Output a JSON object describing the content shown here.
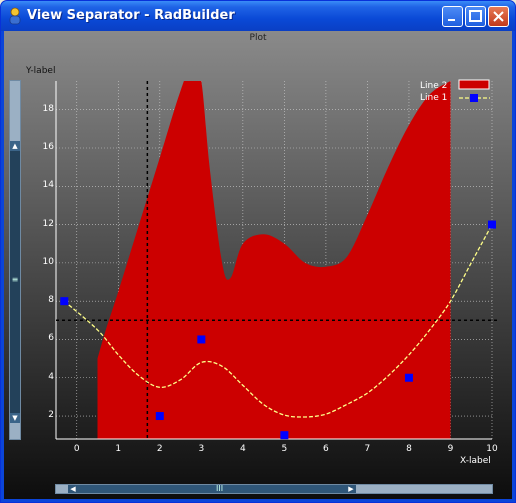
{
  "window": {
    "title": "View Separator - RadBuilder",
    "buttons": [
      "minimize",
      "maximize",
      "close"
    ]
  },
  "plot": {
    "title": "Plot",
    "ylabel": "Y-label",
    "xlabel": "X-label"
  },
  "chart_data": {
    "type": "area",
    "title": "Plot",
    "xlabel": "X-label",
    "ylabel": "Y-label",
    "xlim": [
      -0.5,
      10
    ],
    "ylim": [
      0.8,
      19.5
    ],
    "xticks": [
      "0",
      "1",
      "2",
      "3",
      "4",
      "5",
      "6",
      "7",
      "8",
      "9",
      "10"
    ],
    "yticks": [
      "2",
      "4",
      "6",
      "8",
      "10",
      "12",
      "14",
      "16",
      "18"
    ],
    "grid": true,
    "legend_placement": "top-right",
    "crosshair": {
      "x": 1.7,
      "y": 7.0
    },
    "series": [
      {
        "name": "Line 2",
        "kind": "filled-area",
        "color": "#cc0000",
        "x": [
          0.5,
          0.7,
          1.0,
          1.5,
          2.0,
          2.5,
          2.8,
          3.0,
          3.2,
          3.5,
          3.7,
          4.0,
          4.5,
          5.0,
          5.5,
          6.0,
          6.5,
          7.0,
          7.5,
          8.0,
          8.5,
          9.0
        ],
        "values": [
          5.0,
          6.5,
          8.5,
          12.0,
          15.5,
          19.0,
          20.5,
          19.5,
          15.0,
          10.0,
          9.2,
          11.0,
          11.5,
          11.0,
          10.0,
          9.8,
          10.3,
          12.5,
          15.0,
          17.2,
          18.8,
          19.5
        ]
      },
      {
        "name": "Line 1",
        "kind": "dashed-line-with-markers",
        "color": "#ffff88",
        "marker_color": "#0000ff",
        "x": [
          -0.3,
          2.0,
          3.0,
          5.0,
          8.0,
          10.0
        ],
        "values": [
          8.0,
          2.0,
          6.0,
          1.0,
          4.0,
          12.0
        ],
        "curve_x": [
          -0.3,
          0.5,
          1.0,
          1.5,
          2.0,
          2.5,
          3.0,
          3.5,
          4.0,
          4.5,
          5.0,
          5.5,
          6.0,
          6.5,
          7.0,
          7.5,
          8.0,
          8.5,
          9.0,
          9.5,
          10.0
        ],
        "curve_y": [
          8.0,
          6.5,
          5.2,
          4.1,
          3.5,
          3.9,
          4.8,
          4.6,
          3.6,
          2.6,
          2.05,
          1.95,
          2.1,
          2.6,
          3.2,
          4.1,
          5.2,
          6.5,
          8.0,
          10.0,
          12.0
        ]
      }
    ]
  },
  "legend": [
    {
      "label": "Line 2",
      "swatch": "area",
      "color": "#cc0000"
    },
    {
      "label": "Line 1",
      "swatch": "line",
      "color": "#ffff88",
      "marker_color": "#0000ff"
    }
  ],
  "scrollbars": {
    "vertical_grip": "≡",
    "horizontal_grip": "III"
  }
}
